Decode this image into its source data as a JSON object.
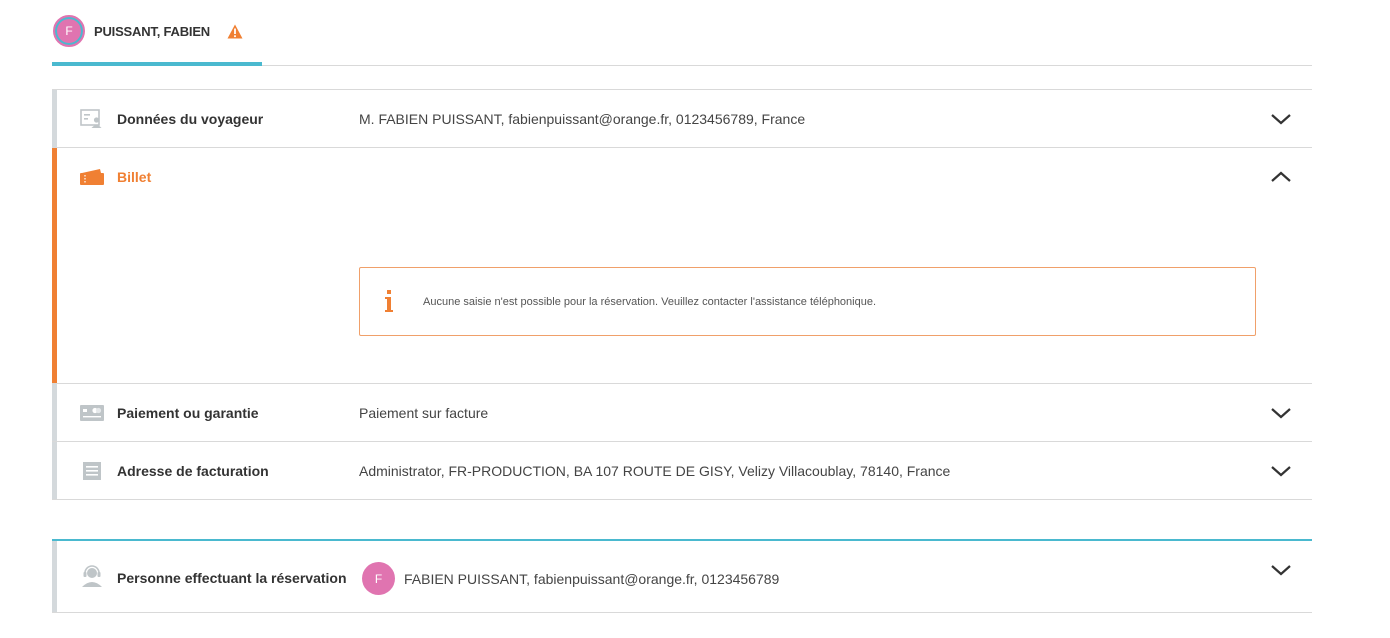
{
  "header": {
    "avatar_initial": "F",
    "traveler_name": "PUISSANT, FABIEN"
  },
  "sections": [
    {
      "title": "Données du voyageur",
      "value": "M. FABIEN PUISSANT, fabienpuissant@orange.fr, 0123456789, France",
      "icon": "traveler-card-icon",
      "expanded": false
    },
    {
      "title": "Billet",
      "icon": "ticket-icon",
      "expanded": true,
      "message": "Aucune saisie n'est possible pour la réservation. Veuillez contacter l'assistance téléphonique."
    },
    {
      "title": "Paiement ou garantie",
      "value": "Paiement sur facture",
      "icon": "credit-card-icon",
      "expanded": false
    },
    {
      "title": "Adresse de facturation",
      "value": "Administrator, FR-PRODUCTION, BA 107 ROUTE DE GISY, Velizy Villacoublay, 78140, France",
      "icon": "document-icon",
      "expanded": false
    }
  ],
  "booker": {
    "title": "Personne effectuant la réservation",
    "avatar_initial": "F",
    "value": "FABIEN PUISSANT, fabienpuissant@orange.fr, 0123456789",
    "icon": "support-agent-icon",
    "expanded": false
  },
  "colors": {
    "accent_teal": "#4ab9cf",
    "accent_orange": "#f08033",
    "avatar_pink": "#e074b0",
    "inactive_bar": "#d4d9dc"
  }
}
